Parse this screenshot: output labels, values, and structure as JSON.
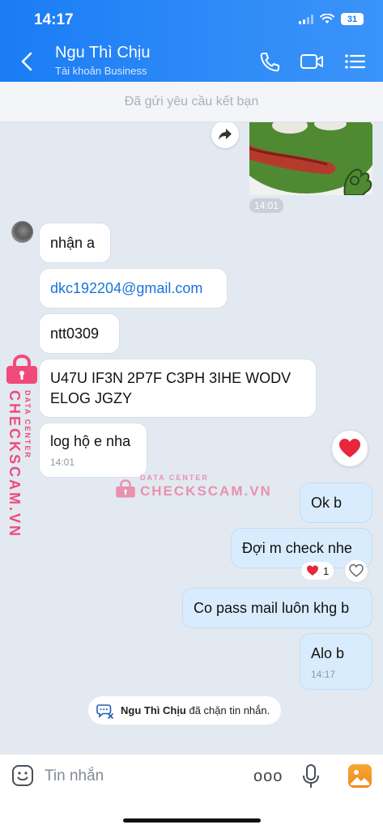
{
  "status": {
    "time": "14:17",
    "battery": "31"
  },
  "header": {
    "name": "Ngu Thì Chịu",
    "subtitle": "Tài khoản Business"
  },
  "friend_bar": {
    "text": "Đã gửi yêu cầu kết bạn"
  },
  "messages": [
    {
      "from": "me",
      "type": "sticker",
      "time": "14:01"
    },
    {
      "from": "them",
      "text": "nhận a"
    },
    {
      "from": "them",
      "text": "dkc192204@gmail.com",
      "link": true
    },
    {
      "from": "them",
      "text": "ntt0309"
    },
    {
      "from": "them",
      "text": "U47U IF3N 2P7F C3PH 3IHE WODV ELOG JGZY"
    },
    {
      "from": "them",
      "text": "log hộ e nha",
      "time": "14:01"
    },
    {
      "from": "me",
      "text": "Ok b"
    },
    {
      "from": "me",
      "text": "Đợi m check nhe",
      "reaction": "1"
    },
    {
      "from": "me",
      "text": "Co pass mail luôn khg b"
    },
    {
      "from": "me",
      "text": "Alo b",
      "time": "14:17"
    }
  ],
  "blocked_notice": {
    "name": "Ngu Thì Chịu",
    "text": " đã chặn tin nhắn."
  },
  "watermark": {
    "top": "DATA CENTER",
    "main": "CHECKSCAM.VN",
    "main_alt": "CHECKSCAM.VN"
  },
  "input": {
    "placeholder": "Tin nhắn",
    "more": "ooo"
  },
  "colors": {
    "header": "#1a7cf5",
    "my_bubble": "#d9ecfd",
    "watermark": "#f04a7a",
    "link": "#1a73d9"
  },
  "icons": [
    "back-icon",
    "phone-icon",
    "video-icon",
    "menu-icon",
    "share-icon",
    "heart-icon",
    "emoji-icon",
    "mic-icon",
    "image-icon",
    "blocked-chat-icon"
  ]
}
